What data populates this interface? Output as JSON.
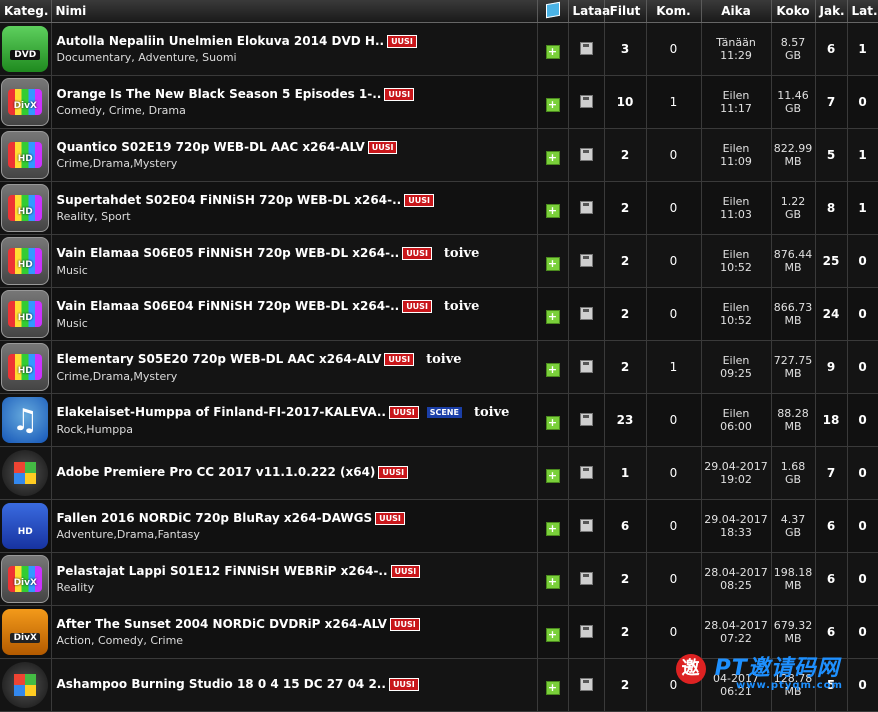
{
  "headers": {
    "kategoria": "Kateg.",
    "nimi": "Nimi",
    "lataa": "Lataa",
    "filut": "Filut",
    "kom": "Kom.",
    "aika": "Aika",
    "koko": "Koko",
    "jak": "Jak.",
    "lat": "Lat."
  },
  "rows": [
    {
      "cat": "dvd",
      "cat_label": "DVD",
      "title": "Autolla Nepaliin Unelmien Elokuva 2014 DVD H..",
      "badge": "UUSI",
      "genre": "Documentary, Adventure, Suomi",
      "extra": "",
      "filut": "3",
      "kom": "0",
      "time1": "Tänään",
      "time2": "11:29",
      "size1": "8.57",
      "size2": "GB",
      "jak": "6",
      "lat": "1"
    },
    {
      "cat": "tv",
      "cat_label": "DivX",
      "title": "Orange Is The New Black Season 5 Episodes 1-..",
      "badge": "UUSI",
      "genre": "Comedy, Crime, Drama",
      "extra": "",
      "filut": "10",
      "kom": "1",
      "time1": "Eilen",
      "time2": "11:17",
      "size1": "11.46",
      "size2": "GB",
      "jak": "7",
      "lat": "0"
    },
    {
      "cat": "tv",
      "cat_label": "HD",
      "title": "Quantico S02E19 720p WEB-DL AAC x264-ALV",
      "badge": "UUSI",
      "genre": "Crime,Drama,Mystery",
      "extra": "",
      "filut": "2",
      "kom": "0",
      "time1": "Eilen",
      "time2": "11:09",
      "size1": "822.99",
      "size2": "MB",
      "jak": "5",
      "lat": "1"
    },
    {
      "cat": "tv",
      "cat_label": "HD",
      "title": "Supertahdet S02E04 FiNNiSH 720p WEB-DL x264-..",
      "badge": "UUSI",
      "genre": "Reality, Sport",
      "extra": "",
      "filut": "2",
      "kom": "0",
      "time1": "Eilen",
      "time2": "11:03",
      "size1": "1.22",
      "size2": "GB",
      "jak": "8",
      "lat": "1"
    },
    {
      "cat": "tv",
      "cat_label": "HD",
      "title": "Vain Elamaa S06E05 FiNNiSH 720p WEB-DL x264-..",
      "badge": "UUSI",
      "genre": "Music",
      "extra": "toive",
      "filut": "2",
      "kom": "0",
      "time1": "Eilen",
      "time2": "10:52",
      "size1": "876.44",
      "size2": "MB",
      "jak": "25",
      "lat": "0"
    },
    {
      "cat": "tv",
      "cat_label": "HD",
      "title": "Vain Elamaa S06E04 FiNNiSH 720p WEB-DL x264-..",
      "badge": "UUSI",
      "genre": "Music",
      "extra": "toive",
      "filut": "2",
      "kom": "0",
      "time1": "Eilen",
      "time2": "10:52",
      "size1": "866.73",
      "size2": "MB",
      "jak": "24",
      "lat": "0"
    },
    {
      "cat": "tv",
      "cat_label": "HD",
      "title": "Elementary S05E20 720p WEB-DL AAC x264-ALV",
      "badge": "UUSI",
      "genre": "Crime,Drama,Mystery",
      "extra": "toive",
      "filut": "2",
      "kom": "1",
      "time1": "Eilen",
      "time2": "09:25",
      "size1": "727.75",
      "size2": "MB",
      "jak": "9",
      "lat": "0"
    },
    {
      "cat": "music",
      "cat_label": "",
      "title": "Elakelaiset-Humppa of Finland-FI-2017-KALEVA..",
      "badge": "UUSI",
      "badge2": "SCENE",
      "genre": "Rock,Humppa",
      "extra": "toive",
      "filut": "23",
      "kom": "0",
      "time1": "Eilen",
      "time2": "06:00",
      "size1": "88.28",
      "size2": "MB",
      "jak": "18",
      "lat": "0"
    },
    {
      "cat": "win",
      "cat_label": "",
      "title": "Adobe Premiere Pro CC 2017 v11.1.0.222 (x64)",
      "badge": "UUSI",
      "genre": "",
      "extra": "",
      "filut": "1",
      "kom": "0",
      "time1": "29.04-2017",
      "time2": "19:02",
      "size1": "1.68",
      "size2": "GB",
      "jak": "7",
      "lat": "0"
    },
    {
      "cat": "movie",
      "cat_label": "HD",
      "title": "Fallen 2016 NORDiC 720p BluRay x264-DAWGS",
      "badge": "UUSI",
      "genre": "Adventure,Drama,Fantasy",
      "extra": "",
      "filut": "6",
      "kom": "0",
      "time1": "29.04-2017",
      "time2": "18:33",
      "size1": "4.37",
      "size2": "GB",
      "jak": "6",
      "lat": "0"
    },
    {
      "cat": "tv",
      "cat_label": "DivX",
      "title": "Pelastajat Lappi S01E12 FiNNiSH WEBRiP x264-..",
      "badge": "UUSI",
      "genre": "Reality",
      "extra": "",
      "filut": "2",
      "kom": "0",
      "time1": "28.04-2017",
      "time2": "08:25",
      "size1": "198.18",
      "size2": "MB",
      "jak": "6",
      "lat": "0"
    },
    {
      "cat": "divx",
      "cat_label": "DivX",
      "title": "After The Sunset 2004 NORDiC DVDRiP x264-ALV",
      "badge": "UUSI",
      "genre": "Action, Comedy, Crime",
      "extra": "",
      "filut": "2",
      "kom": "0",
      "time1": "28.04-2017",
      "time2": "07:22",
      "size1": "679.32",
      "size2": "MB",
      "jak": "6",
      "lat": "0"
    },
    {
      "cat": "win",
      "cat_label": "",
      "title": "Ashampoo Burning Studio 18 0 4 15 DC 27 04 2..",
      "badge": "UUSI",
      "genre": "",
      "extra": "",
      "filut": "2",
      "kom": "0",
      "time1": "04-2017",
      "time2": "06:21",
      "size1": "128.78",
      "size2": "MB",
      "jak": "5",
      "lat": "0"
    }
  ],
  "watermark": {
    "text": "PT邀请码网",
    "url": "www.ptyqm.com",
    "circle": "邀"
  }
}
